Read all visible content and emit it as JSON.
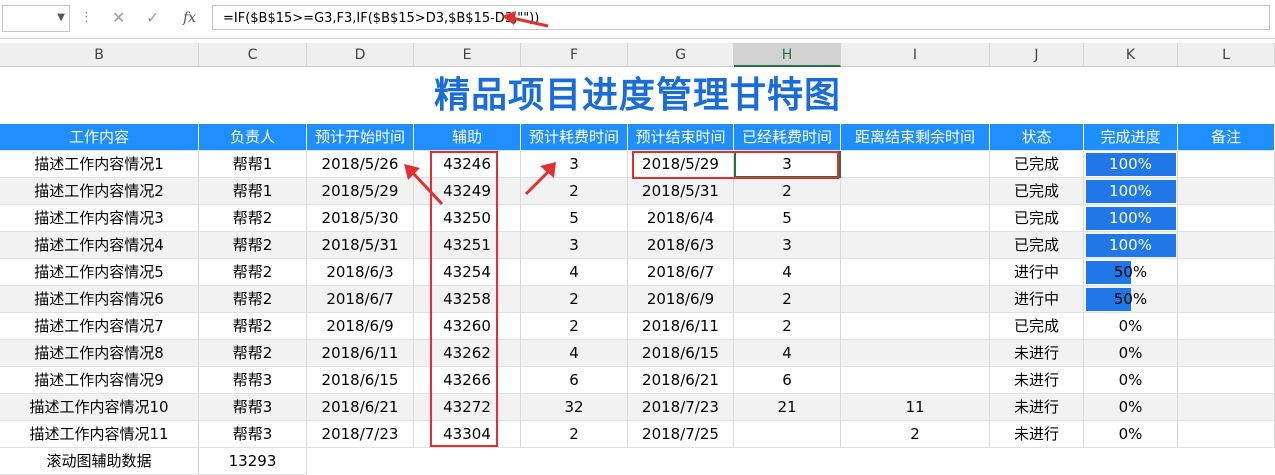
{
  "formula_bar": {
    "name_box": "",
    "cancel_icon": "✕",
    "enter_icon": "✓",
    "fx_label": "fx",
    "formula": "=IF($B$15>=G3,F3,IF($B$15>D3,$B$15-D3,\"\"))"
  },
  "columns": [
    "B",
    "C",
    "D",
    "E",
    "F",
    "G",
    "H",
    "I",
    "J",
    "K",
    "L"
  ],
  "selected_column": "H",
  "title": "精品项目进度管理甘特图",
  "headers": [
    "工作内容",
    "负责人",
    "预计开始时间",
    "辅助",
    "预计耗费时间",
    "预计结束时间",
    "已经耗费时间",
    "距离结束剩余时间",
    "状态",
    "完成进度",
    "备注"
  ],
  "rows": [
    {
      "task": "描述工作内容情况1",
      "owner": "帮帮1",
      "start": "2018/5/26",
      "aux": "43246",
      "est": "3",
      "end": "2018/5/29",
      "spent": "3",
      "remain": "",
      "status": "已完成",
      "progress": "100%",
      "progress_fraction": 1.0,
      "note": ""
    },
    {
      "task": "描述工作内容情况2",
      "owner": "帮帮1",
      "start": "2018/5/29",
      "aux": "43249",
      "est": "2",
      "end": "2018/5/31",
      "spent": "2",
      "remain": "",
      "status": "已完成",
      "progress": "100%",
      "progress_fraction": 1.0,
      "note": ""
    },
    {
      "task": "描述工作内容情况3",
      "owner": "帮帮2",
      "start": "2018/5/30",
      "aux": "43250",
      "est": "5",
      "end": "2018/6/4",
      "spent": "5",
      "remain": "",
      "status": "已完成",
      "progress": "100%",
      "progress_fraction": 1.0,
      "note": ""
    },
    {
      "task": "描述工作内容情况4",
      "owner": "帮帮2",
      "start": "2018/5/31",
      "aux": "43251",
      "est": "3",
      "end": "2018/6/3",
      "spent": "3",
      "remain": "",
      "status": "已完成",
      "progress": "100%",
      "progress_fraction": 1.0,
      "note": ""
    },
    {
      "task": "描述工作内容情况5",
      "owner": "帮帮2",
      "start": "2018/6/3",
      "aux": "43254",
      "est": "4",
      "end": "2018/6/7",
      "spent": "4",
      "remain": "",
      "status": "进行中",
      "progress": "50%",
      "progress_fraction": 0.5,
      "note": ""
    },
    {
      "task": "描述工作内容情况6",
      "owner": "帮帮2",
      "start": "2018/6/7",
      "aux": "43258",
      "est": "2",
      "end": "2018/6/9",
      "spent": "2",
      "remain": "",
      "status": "进行中",
      "progress": "50%",
      "progress_fraction": 0.5,
      "note": ""
    },
    {
      "task": "描述工作内容情况7",
      "owner": "帮帮2",
      "start": "2018/6/9",
      "aux": "43260",
      "est": "2",
      "end": "2018/6/11",
      "spent": "2",
      "remain": "",
      "status": "已完成",
      "progress": "0%",
      "progress_fraction": 0,
      "note": ""
    },
    {
      "task": "描述工作内容情况8",
      "owner": "帮帮2",
      "start": "2018/6/11",
      "aux": "43262",
      "est": "4",
      "end": "2018/6/15",
      "spent": "4",
      "remain": "",
      "status": "未进行",
      "progress": "0%",
      "progress_fraction": 0,
      "note": ""
    },
    {
      "task": "描述工作内容情况9",
      "owner": "帮帮3",
      "start": "2018/6/15",
      "aux": "43266",
      "est": "6",
      "end": "2018/6/21",
      "spent": "6",
      "remain": "",
      "status": "未进行",
      "progress": "0%",
      "progress_fraction": 0,
      "note": ""
    },
    {
      "task": "描述工作内容情况10",
      "owner": "帮帮3",
      "start": "2018/6/21",
      "aux": "43272",
      "est": "32",
      "end": "2018/7/23",
      "spent": "21",
      "remain": "11",
      "status": "未进行",
      "progress": "0%",
      "progress_fraction": 0,
      "note": ""
    },
    {
      "task": "描述工作内容情况11",
      "owner": "帮帮3",
      "start": "2018/7/23",
      "aux": "43304",
      "est": "2",
      "end": "2018/7/25",
      "spent": "",
      "remain": "2",
      "status": "未进行",
      "progress": "0%",
      "progress_fraction": 0,
      "note": ""
    }
  ],
  "footer_row": {
    "label": "滚动图辅助数据",
    "value": "13293"
  },
  "colors": {
    "header_blue": "#1f8fff",
    "title_blue": "#1a6dd8",
    "progress_blue": "#1f77e8",
    "annotation_red": "#e03030"
  }
}
